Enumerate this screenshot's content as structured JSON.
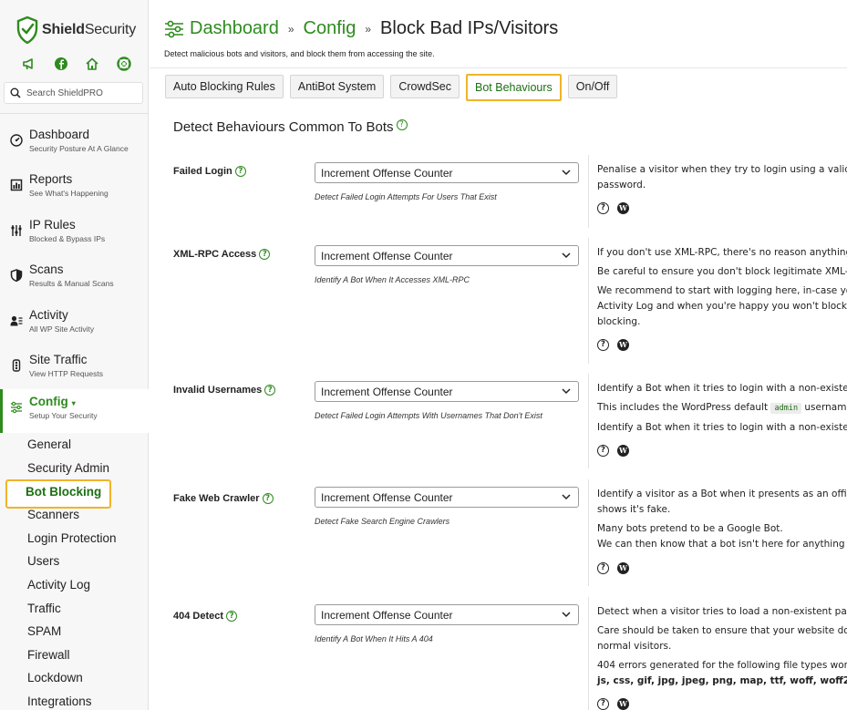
{
  "brand": {
    "name_bold": "Shield",
    "name_regular": "Security",
    "accent": "#2e8b1e",
    "highlight": "#f0b429"
  },
  "sidebar": {
    "quick_icons": [
      "megaphone-icon",
      "facebook-icon",
      "home-icon",
      "lifebuoy-icon"
    ],
    "search_placeholder": "Search ShieldPRO",
    "nav": [
      {
        "title": "Dashboard",
        "sub": "Security Posture At A Glance",
        "icon": "gauge-icon"
      },
      {
        "title": "Reports",
        "sub": "See What's Happening",
        "icon": "report-icon"
      },
      {
        "title": "IP Rules",
        "sub": "Blocked & Bypass IPs",
        "icon": "network-icon"
      },
      {
        "title": "Scans",
        "sub": "Results & Manual Scans",
        "icon": "shield-icon"
      },
      {
        "title": "Activity",
        "sub": "All WP Site Activity",
        "icon": "user-activity-icon"
      },
      {
        "title": "Site Traffic",
        "sub": "View HTTP Requests",
        "icon": "traffic-icon"
      },
      {
        "title": "Config",
        "sub": "Setup Your Security",
        "icon": "sliders-icon",
        "caret": "▾"
      }
    ],
    "config_items": [
      "General",
      "Security Admin",
      "Bot Blocking",
      "Scanners",
      "Login Protection",
      "Users",
      "Activity Log",
      "Traffic",
      "SPAM",
      "Firewall",
      "Lockdown",
      "Integrations"
    ]
  },
  "header": {
    "crumbs": [
      "Dashboard",
      "Config"
    ],
    "separator": "»",
    "current": "Block Bad IPs/Visitors",
    "description": "Detect malicious bots and visitors, and block them from accessing the site."
  },
  "tabs": [
    "Auto Blocking Rules",
    "AntiBot System",
    "CrowdSec",
    "Bot Behaviours",
    "On/Off"
  ],
  "section_title": "Detect Behaviours Common To Bots",
  "options": [
    {
      "label": "Failed Login",
      "value": "Increment Offense Counter",
      "hint": "Detect Failed Login Attempts For Users That Exist",
      "desc": [
        "Penalise a visitor when they try to login using a valid",
        "password."
      ]
    },
    {
      "label": "XML-RPC Access",
      "value": "Increment Offense Counter",
      "hint": "Identify A Bot When It Accesses XML-RPC",
      "desc": [
        "If you don't use XML-RPC, there's no reason anything",
        "Be careful to ensure you don't block legitimate XML-R",
        "We recommend to start with logging here, in-case yo",
        "Activity Log and when you're happy you won't block v",
        "blocking."
      ]
    },
    {
      "label": "Invalid Usernames",
      "value": "Increment Offense Counter",
      "hint": "Detect Failed Login Attempts With Usernames That Don't Exist",
      "desc": [
        "Identify a Bot when it tries to login with a non-existen",
        "This includes the WordPress default",
        "admin",
        "username",
        "Identify a Bot when it tries to login with a non-existen"
      ]
    },
    {
      "label": "Fake Web Crawler",
      "value": "Increment Offense Counter",
      "hint": "Detect Fake Search Engine Crawlers",
      "desc": [
        "Identify a visitor as a Bot when it presents as an offici",
        "shows it's fake.",
        "Many bots pretend to be a Google Bot.",
        "We can then know that a bot isn't here for anything g"
      ]
    },
    {
      "label": "404 Detect",
      "value": "Increment Offense Counter",
      "hint": "Identify A Bot When It Hits A 404",
      "desc": [
        "Detect when a visitor tries to load a non-existent pag",
        "Care should be taken to ensure that your website doe",
        "normal visitors.",
        "404 errors generated for the following file types won",
        "js, css, gif, jpg, jpeg, png, map, ttf, woff, woff2"
      ]
    }
  ],
  "icon_glyphs": {
    "help": "?",
    "wordpress": "W"
  }
}
